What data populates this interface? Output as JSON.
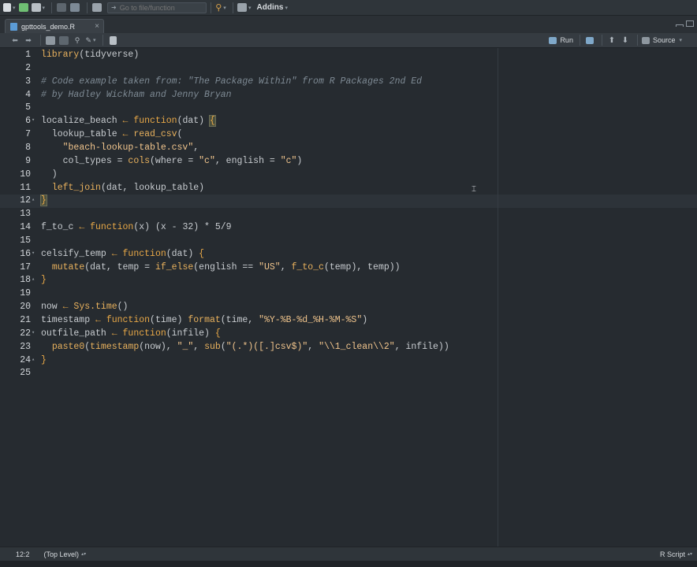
{
  "toolbar": {
    "goto_placeholder": "Go to file/function",
    "addins_label": "Addins",
    "caret": "▾"
  },
  "tab": {
    "filename": "gpttools_demo.R",
    "close": "×"
  },
  "editor_toolbar": {
    "run_label": "Run",
    "source_label": "Source",
    "up": "⬆",
    "down": "⬇",
    "back": "⬅",
    "forward": "➡"
  },
  "code": {
    "lines": [
      {
        "n": "1",
        "fold": "",
        "segs": [
          [
            "fn",
            "library"
          ],
          [
            "op",
            "(tidyverse)"
          ]
        ]
      },
      {
        "n": "2",
        "fold": "",
        "segs": []
      },
      {
        "n": "3",
        "fold": "",
        "segs": [
          [
            "com",
            "# Code example taken from: \"The Package Within\" from R Packages 2nd Ed"
          ]
        ]
      },
      {
        "n": "4",
        "fold": "",
        "segs": [
          [
            "com",
            "# by Hadley Wickham and Jenny Bryan"
          ]
        ]
      },
      {
        "n": "5",
        "fold": "",
        "segs": []
      },
      {
        "n": "6",
        "fold": "▾",
        "segs": [
          [
            "op",
            "localize_beach "
          ],
          [
            "kw",
            "←"
          ],
          [
            "op",
            " "
          ],
          [
            "kw",
            "function"
          ],
          [
            "op",
            "(dat) "
          ],
          [
            "brace",
            "{"
          ]
        ]
      },
      {
        "n": "7",
        "fold": "",
        "segs": [
          [
            "op",
            "  lookup_table "
          ],
          [
            "kw",
            "←"
          ],
          [
            "op",
            " "
          ],
          [
            "fn",
            "read_csv"
          ],
          [
            "op",
            "("
          ]
        ]
      },
      {
        "n": "8",
        "fold": "",
        "segs": [
          [
            "op",
            "    "
          ],
          [
            "str",
            "\"beach-lookup-table.csv\""
          ],
          [
            "op",
            ","
          ]
        ]
      },
      {
        "n": "9",
        "fold": "",
        "segs": [
          [
            "op",
            "    col_types = "
          ],
          [
            "fn",
            "cols"
          ],
          [
            "op",
            "(where = "
          ],
          [
            "str",
            "\"c\""
          ],
          [
            "op",
            ", english = "
          ],
          [
            "str",
            "\"c\""
          ],
          [
            "op",
            ")"
          ]
        ]
      },
      {
        "n": "10",
        "fold": "",
        "segs": [
          [
            "op",
            "  )"
          ]
        ]
      },
      {
        "n": "11",
        "fold": "",
        "segs": [
          [
            "op",
            "  "
          ],
          [
            "fn",
            "left_join"
          ],
          [
            "op",
            "(dat, lookup_table)"
          ]
        ]
      },
      {
        "n": "12",
        "fold": "▴",
        "segs": [
          [
            "brace",
            "}"
          ]
        ]
      },
      {
        "n": "13",
        "fold": "",
        "segs": []
      },
      {
        "n": "14",
        "fold": "",
        "segs": [
          [
            "op",
            "f_to_c "
          ],
          [
            "kw",
            "←"
          ],
          [
            "op",
            " "
          ],
          [
            "kw",
            "function"
          ],
          [
            "op",
            "(x) (x - 32) * 5/9"
          ]
        ]
      },
      {
        "n": "15",
        "fold": "",
        "segs": []
      },
      {
        "n": "16",
        "fold": "▾",
        "segs": [
          [
            "op",
            "celsify_temp "
          ],
          [
            "kw",
            "←"
          ],
          [
            "op",
            " "
          ],
          [
            "kw",
            "function"
          ],
          [
            "op",
            "(dat) "
          ],
          [
            "fb",
            "{"
          ]
        ]
      },
      {
        "n": "17",
        "fold": "",
        "segs": [
          [
            "op",
            "  "
          ],
          [
            "fn",
            "mutate"
          ],
          [
            "op",
            "(dat, temp = "
          ],
          [
            "fn",
            "if_else"
          ],
          [
            "op",
            "(english == "
          ],
          [
            "str",
            "\"US\""
          ],
          [
            "op",
            ", "
          ],
          [
            "fn",
            "f_to_c"
          ],
          [
            "op",
            "(temp), temp))"
          ]
        ]
      },
      {
        "n": "18",
        "fold": "▴",
        "segs": [
          [
            "fb",
            "}"
          ]
        ]
      },
      {
        "n": "19",
        "fold": "",
        "segs": []
      },
      {
        "n": "20",
        "fold": "",
        "segs": [
          [
            "op",
            "now "
          ],
          [
            "kw",
            "←"
          ],
          [
            "op",
            " "
          ],
          [
            "fn",
            "Sys.time"
          ],
          [
            "op",
            "()"
          ]
        ]
      },
      {
        "n": "21",
        "fold": "",
        "segs": [
          [
            "op",
            "timestamp "
          ],
          [
            "kw",
            "←"
          ],
          [
            "op",
            " "
          ],
          [
            "kw",
            "function"
          ],
          [
            "op",
            "(time) "
          ],
          [
            "fn",
            "format"
          ],
          [
            "op",
            "(time, "
          ],
          [
            "str",
            "\"%Y-%B-%d_%H-%M-%S\""
          ],
          [
            "op",
            ")"
          ]
        ]
      },
      {
        "n": "22",
        "fold": "▾",
        "segs": [
          [
            "op",
            "outfile_path "
          ],
          [
            "kw",
            "←"
          ],
          [
            "op",
            " "
          ],
          [
            "kw",
            "function"
          ],
          [
            "op",
            "(infile) "
          ],
          [
            "fb",
            "{"
          ]
        ]
      },
      {
        "n": "23",
        "fold": "",
        "segs": [
          [
            "op",
            "  "
          ],
          [
            "fn",
            "paste0"
          ],
          [
            "op",
            "("
          ],
          [
            "fn",
            "timestamp"
          ],
          [
            "op",
            "(now), "
          ],
          [
            "str",
            "\"_\""
          ],
          [
            "op",
            ", "
          ],
          [
            "fn",
            "sub"
          ],
          [
            "op",
            "("
          ],
          [
            "str",
            "\"(.*)([.]csv$)\""
          ],
          [
            "op",
            ", "
          ],
          [
            "str",
            "\"\\\\1_clean\\\\2\""
          ],
          [
            "op",
            ", infile))"
          ]
        ]
      },
      {
        "n": "24",
        "fold": "▴",
        "segs": [
          [
            "fb",
            "}"
          ]
        ]
      },
      {
        "n": "25",
        "fold": "",
        "segs": []
      }
    ]
  },
  "status": {
    "position": "12:2",
    "scope": "(Top Level)",
    "file_type": "R Script"
  }
}
